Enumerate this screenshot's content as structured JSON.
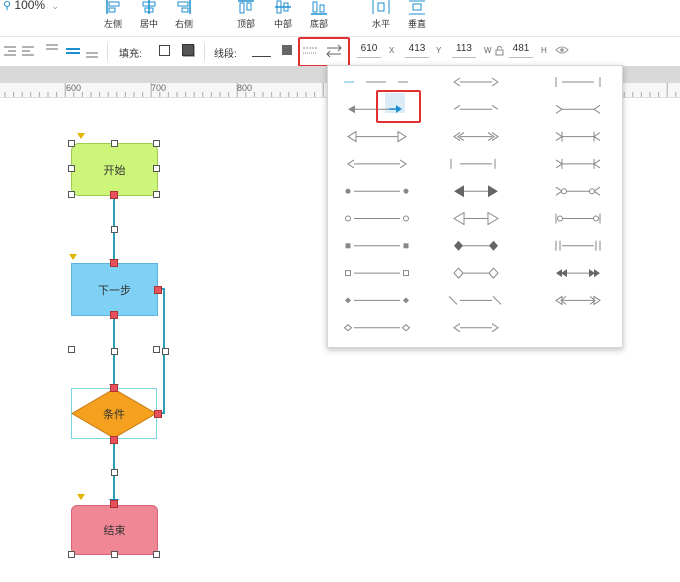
{
  "toolbar": {
    "zoom": "100%",
    "align_buttons": [
      {
        "label": "左侧",
        "icon": "align-left-icon"
      },
      {
        "label": "居中",
        "icon": "align-center-icon"
      },
      {
        "label": "右侧",
        "icon": "align-right-icon"
      },
      {
        "label": "顶部",
        "icon": "align-top-icon"
      },
      {
        "label": "中部",
        "icon": "align-middle-icon"
      },
      {
        "label": "底部",
        "icon": "align-bottom-icon"
      },
      {
        "label": "水平",
        "icon": "distribute-horizontal-icon"
      },
      {
        "label": "垂直",
        "icon": "distribute-vertical-icon"
      }
    ]
  },
  "format_bar": {
    "fill_label": "填充:",
    "line_label": "线段:",
    "x_value": "610",
    "x_label": "X",
    "y_value": "413",
    "y_label": "Y",
    "w_value": "113",
    "w_label": "W",
    "h_value": "481",
    "h_label": "H"
  },
  "ruler": {
    "labels": [
      "600",
      "700",
      "800"
    ]
  },
  "flowchart": {
    "start": {
      "label": "开始",
      "color": "#ccf57a"
    },
    "step": {
      "label": "下一步",
      "color": "#7fd0f5"
    },
    "condition": {
      "label": "条件",
      "color": "#f5a11f"
    },
    "end": {
      "label": "结束",
      "color": "#f08795"
    }
  },
  "colors": {
    "accent": "#1d8fd0",
    "connector": "#2a9fb5",
    "highlight": "#e03030"
  },
  "arrow_popup": {
    "selected_index": 4
  }
}
